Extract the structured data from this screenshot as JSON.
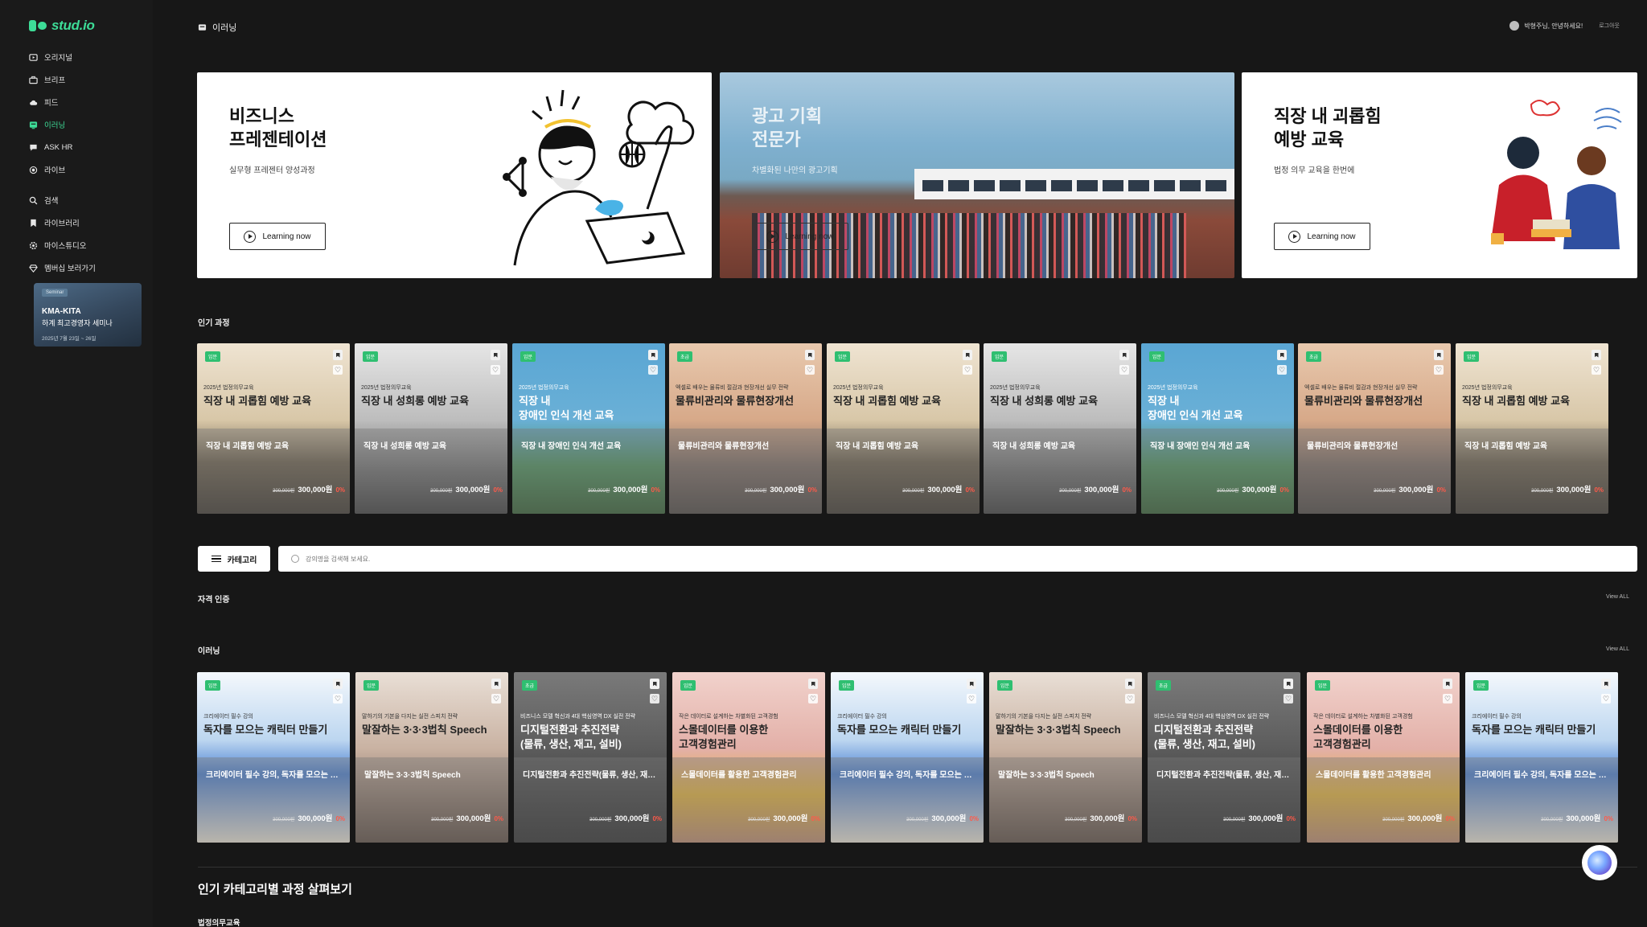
{
  "brand": {
    "logo_text": "stud.io",
    "accent": "#3ddc97"
  },
  "sidebar": {
    "items": [
      {
        "label": "오리지널",
        "icon": "video-icon"
      },
      {
        "label": "브리프",
        "icon": "briefcase-icon"
      },
      {
        "label": "피드",
        "icon": "cloud-icon"
      },
      {
        "label": "이러닝",
        "icon": "elearning-icon",
        "active": true
      },
      {
        "label": "ASK HR",
        "icon": "chat-icon"
      },
      {
        "label": "라이브",
        "icon": "live-icon"
      },
      {
        "label": "검색",
        "icon": "search-icon"
      },
      {
        "label": "라이브러리",
        "icon": "bookmark-icon"
      },
      {
        "label": "마이스튜디오",
        "icon": "gear-icon"
      },
      {
        "label": "멤버십 보러가기",
        "icon": "diamond-icon"
      }
    ],
    "promo": {
      "badge": "Seminar",
      "title": "KMA-KITA",
      "subtitle": "하계 최고경영자 세미나",
      "date": "2025년 7월 23일 ~ 26일"
    }
  },
  "topbar": {
    "title": "이러닝",
    "user": "박형주님, 안녕하세요!",
    "logout": "로그아웃"
  },
  "hero": [
    {
      "title": "비즈니스\n프레젠테이션",
      "subtitle": "실무형 프레젠터 양성과정",
      "button": "Learning now"
    },
    {
      "title": "광고 기획\n전문가",
      "subtitle": "차별화된 나만의 광고기획",
      "button": "Learning now"
    },
    {
      "title": "직장 내 괴롭힘\n예방 교육",
      "subtitle": "법정 의무 교육을 한번에",
      "button": "Learning now"
    }
  ],
  "popular": {
    "title": "인기 과정",
    "cards": [
      {
        "level": "입문",
        "eyebrow": "2025년 법정의무교육",
        "title": "직장 내 괴롭힘 예방 교육",
        "name": "직장 내 괴롭힘 예방 교육",
        "old": "300,000원",
        "price": "300,000원",
        "disc": "0%"
      },
      {
        "level": "입문",
        "eyebrow": "2025년 법정의무교육",
        "title": "직장 내 성희롱 예방 교육",
        "name": "직장 내 성희롱 예방 교육",
        "old": "300,000원",
        "price": "300,000원",
        "disc": "0%"
      },
      {
        "level": "입문",
        "eyebrow": "2025년 법정의무교육",
        "title": "직장 내\n장애인 인식 개선 교육",
        "name": "직장 내 장애인 인식 개선 교육",
        "old": "300,000원",
        "price": "300,000원",
        "disc": "0%"
      },
      {
        "level": "초급",
        "eyebrow": "엑셀로 배우는 물류비 절감과 현장개선 실무 전략",
        "title": "물류비관리와 물류현장개선",
        "name": "물류비관리와 물류현장개선",
        "old": "300,000원",
        "price": "300,000원",
        "disc": "0%"
      },
      {
        "level": "입문",
        "eyebrow": "2025년 법정의무교육",
        "title": "직장 내 괴롭힘 예방 교육",
        "name": "직장 내 괴롭힘 예방 교육",
        "old": "300,000원",
        "price": "300,000원",
        "disc": "0%"
      },
      {
        "level": "입문",
        "eyebrow": "2025년 법정의무교육",
        "title": "직장 내 성희롱 예방 교육",
        "name": "직장 내 성희롱 예방 교육",
        "old": "300,000원",
        "price": "300,000원",
        "disc": "0%"
      },
      {
        "level": "입문",
        "eyebrow": "2025년 법정의무교육",
        "title": "직장 내\n장애인 인식 개선 교육",
        "name": "직장 내 장애인 인식 개선 교육",
        "old": "300,000원",
        "price": "300,000원",
        "disc": "0%"
      },
      {
        "level": "초급",
        "eyebrow": "엑셀로 배우는 물류비 절감과 현장개선 실무 전략",
        "title": "물류비관리와 물류현장개선",
        "name": "물류비관리와 물류현장개선",
        "old": "300,000원",
        "price": "300,000원",
        "disc": "0%"
      },
      {
        "level": "입문",
        "eyebrow": "2025년 법정의무교육",
        "title": "직장 내 괴롭힘 예방 교육",
        "name": "직장 내 괴롭힘 예방 교육",
        "old": "300,000원",
        "price": "300,000원",
        "disc": "0%"
      }
    ]
  },
  "search": {
    "category_label": "카테고리",
    "placeholder": "강의명을 검색해 보세요."
  },
  "certification": {
    "title": "자격 인증",
    "view_all": "View ALL"
  },
  "elearning": {
    "title": "이러닝",
    "view_all": "View ALL",
    "cards": [
      {
        "level": "입문",
        "eyebrow": "크리에이터 필수 강의",
        "title": "독자를 모으는 캐릭터 만들기",
        "name": "크리에이터 필수 강의, 독자를 모으는 캐릭터 만들기",
        "old": "300,000원",
        "price": "300,000원",
        "disc": "0%"
      },
      {
        "level": "입문",
        "eyebrow": "말하기의 기본을 다지는 실전 스피치 전략",
        "title": "말잘하는 3·3·3법칙 Speech",
        "name": "말잘하는 3·3·3법칙 Speech",
        "old": "300,000원",
        "price": "300,000원",
        "disc": "0%"
      },
      {
        "level": "초급",
        "eyebrow": "비즈니스 모델 혁신과 4대 핵심영역 DX 실전 전략",
        "title": "디지털전환과 추진전략\n(물류, 생산, 재고, 설비)",
        "name": "디지털전환과 추진전략(물류, 생산, 재고, 설비)",
        "old": "300,000원",
        "price": "300,000원",
        "disc": "0%"
      },
      {
        "level": "입문",
        "eyebrow": "작은 데이터로 설계하는 차별화된 고객경험",
        "title": "스몰데이터를 이용한\n고객경험관리",
        "name": "스몰데이터를 활용한 고객경험관리",
        "old": "300,000원",
        "price": "300,000원",
        "disc": "0%"
      },
      {
        "level": "입문",
        "eyebrow": "크리에이터 필수 강의",
        "title": "독자를 모으는 캐릭터 만들기",
        "name": "크리에이터 필수 강의, 독자를 모으는 캐릭터 만들기",
        "old": "300,000원",
        "price": "300,000원",
        "disc": "0%"
      },
      {
        "level": "입문",
        "eyebrow": "말하기의 기본을 다지는 실전 스피치 전략",
        "title": "말잘하는 3·3·3법칙 Speech",
        "name": "말잘하는 3·3·3법칙 Speech",
        "old": "300,000원",
        "price": "300,000원",
        "disc": "0%"
      },
      {
        "level": "초급",
        "eyebrow": "비즈니스 모델 혁신과 4대 핵심영역 DX 실전 전략",
        "title": "디지털전환과 추진전략\n(물류, 생산, 재고, 설비)",
        "name": "디지털전환과 추진전략(물류, 생산, 재고, 설비)",
        "old": "300,000원",
        "price": "300,000원",
        "disc": "0%"
      },
      {
        "level": "입문",
        "eyebrow": "작은 데이터로 설계하는 차별화된 고객경험",
        "title": "스몰데이터를 이용한\n고객경험관리",
        "name": "스몰데이터를 활용한 고객경험관리",
        "old": "300,000원",
        "price": "300,000원",
        "disc": "0%"
      },
      {
        "level": "입문",
        "eyebrow": "크리에이터 필수 강의",
        "title": "독자를 모으는 캐릭터 만들기",
        "name": "크리에이터 필수 강의, 독자를 모으는 캐릭터 만들기",
        "old": "300,000원",
        "price": "300,000원",
        "disc": "0%"
      }
    ]
  },
  "popular_categories": {
    "title": "인기 카테고리별 과정 살펴보기",
    "first_category": "법정의무교육"
  }
}
